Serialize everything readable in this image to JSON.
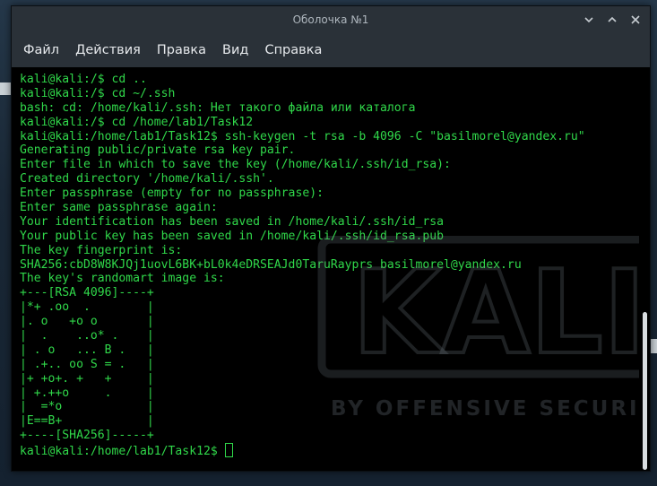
{
  "window": {
    "title": "Оболочка №1"
  },
  "menu": {
    "items": [
      "Файл",
      "Действия",
      "Правка",
      "Вид",
      "Справка"
    ]
  },
  "terminal": {
    "lines": [
      "kali@kali:/$ cd ..",
      "kali@kali:/$ cd ~/.ssh",
      "bash: cd: /home/kali/.ssh: Нет такого файла или каталога",
      "kali@kali:/$ cd /home/lab1/Task12",
      "kali@kali:/home/lab1/Task12$ ssh-keygen -t rsa -b 4096 -C \"basilmorel@yandex.ru\"",
      "Generating public/private rsa key pair.",
      "Enter file in which to save the key (/home/kali/.ssh/id_rsa):",
      "Created directory '/home/kali/.ssh'.",
      "Enter passphrase (empty for no passphrase):",
      "Enter same passphrase again:",
      "Your identification has been saved in /home/kali/.ssh/id_rsa",
      "Your public key has been saved in /home/kali/.ssh/id_rsa.pub",
      "The key fingerprint is:",
      "SHA256:cbD8W8KJQj1uovL6BK+bL0k4eDRSEAJd0TaruRayprs basilmorel@yandex.ru",
      "The key's randomart image is:",
      "+---[RSA 4096]----+",
      "|*+ .oo  .        |",
      "|. o   +o o       |",
      "|  .    ..o* .    |",
      "| . o   ... B .   |",
      "| .+.. oo S = .   |",
      "|+ +o+. +   +     |",
      "| +.++o     .     |",
      "|  =*o            |",
      "|E==B+            |",
      "+----[SHA256]-----+"
    ],
    "prompt": "kali@kali:/home/lab1/Task12$ "
  },
  "wallpaper": {
    "logo_text": "KALI",
    "tagline": "BY OFFENSIVE SECURITY"
  },
  "colors": {
    "terminal_text": "#30d84a",
    "terminal_bg": "#000000",
    "titlebar_bg": "#2a3138",
    "menu_text": "#e6e9ec"
  }
}
